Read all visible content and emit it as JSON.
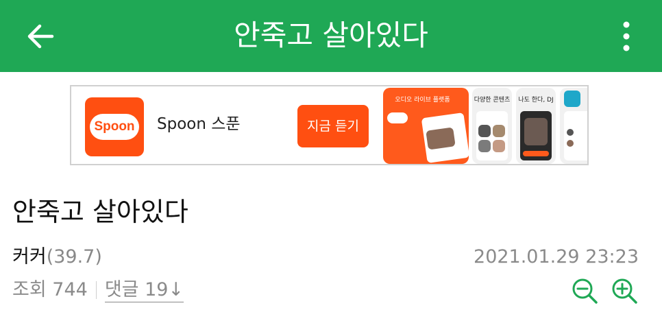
{
  "header": {
    "title": "안죽고 살아있다",
    "back_icon": "arrow-left-icon",
    "menu_icon": "more-vertical-icon",
    "color": "#1fa855"
  },
  "ad": {
    "logo_text": "Spoon",
    "app_name": "Spoon 스푼",
    "cta_label": "지금 듣기",
    "brand_color": "#ff4f11",
    "screenshots": [
      {
        "caption": "오디오 라이브 플랫폼"
      },
      {
        "caption": "다양한 콘텐츠"
      },
      {
        "caption": "나도 한다, DJ"
      }
    ]
  },
  "article": {
    "title": "안죽고 살아있다",
    "author": "커커",
    "author_level": "(39.7)",
    "datetime": "2021.01.29 23:23",
    "views_label": "조회 744",
    "comments_label": "댓글 19↓",
    "zoom_out_icon": "zoom-out-icon",
    "zoom_in_icon": "zoom-in-icon",
    "accent_color": "#1fa855"
  }
}
